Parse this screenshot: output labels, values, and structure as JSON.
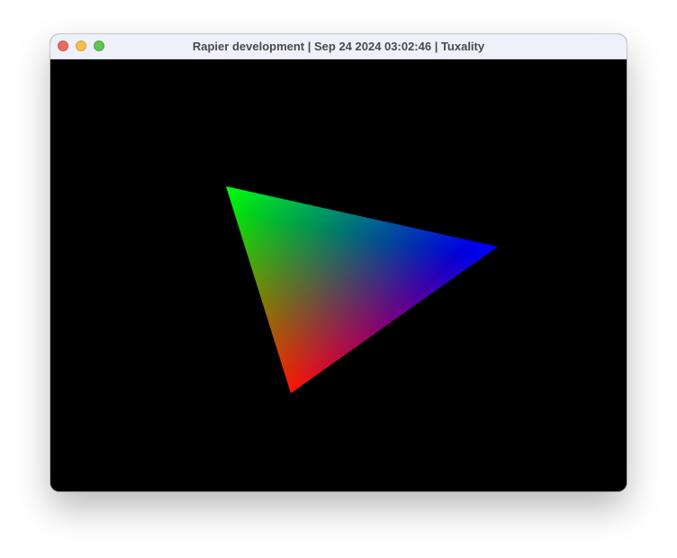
{
  "window": {
    "title": "Rapier development | Sep 24 2024 03:02:46 | Tuxality",
    "buttons": {
      "close": "close-icon",
      "minimize": "minimize-icon",
      "zoom": "zoom-icon"
    },
    "colors": {
      "close": "#ed6a5e",
      "minimize": "#f5bf4f",
      "zoom": "#61c554",
      "titlebar": "#eef1f9",
      "background": "#000000"
    }
  },
  "scene": {
    "object": "triangle",
    "vertex_colors": {
      "top_left": "#00ff00",
      "right": "#0000ff",
      "bottom": "#ff0000"
    }
  }
}
